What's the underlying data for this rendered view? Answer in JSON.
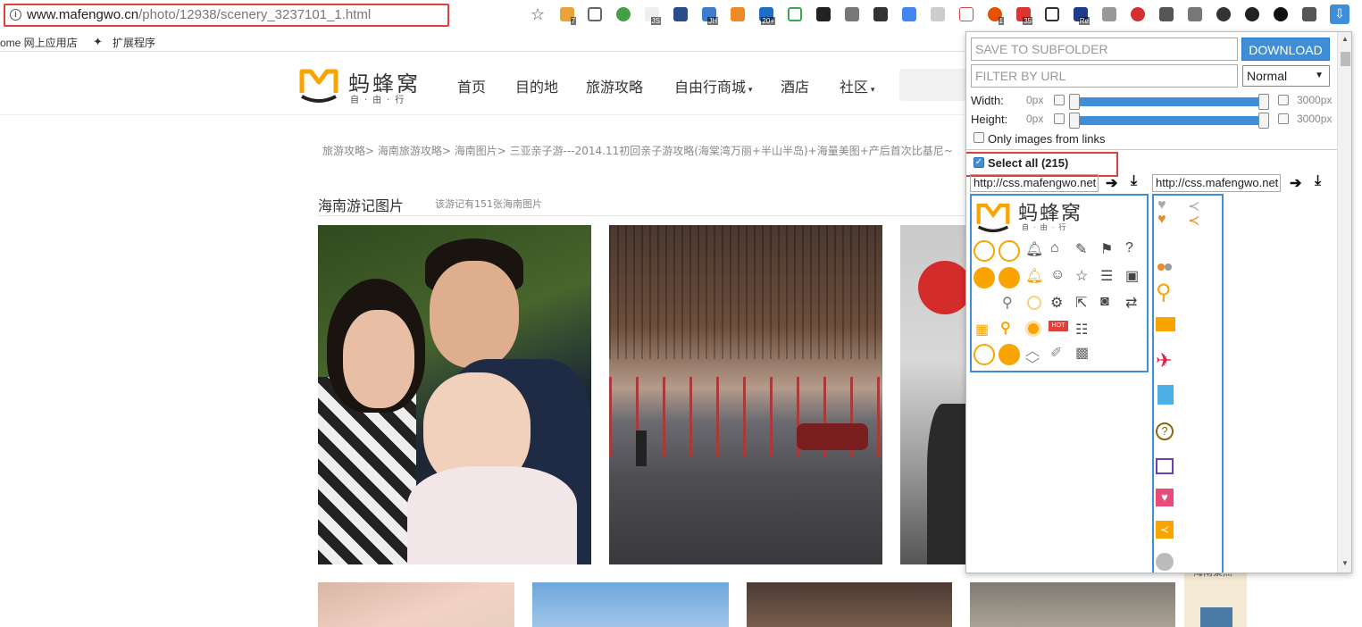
{
  "browser": {
    "url_host": "www.mafengwo.cn",
    "url_path": "/photo/12938/scenery_3237101_1.html",
    "bookmarks": [
      "ome 网上应用店",
      "扩展程序"
    ],
    "extension_badges": [
      "7",
      "JS",
      "JH",
      "20+",
      "1",
      "35",
      "Re"
    ]
  },
  "site": {
    "logo_text": "蚂蜂窝",
    "logo_sub": "自·由·行",
    "nav": [
      "首页",
      "目的地",
      "旅游攻略",
      "自由行商城",
      "酒店",
      "社区"
    ]
  },
  "content": {
    "breadcrumb": "旅游攻略> 海南旅游攻略> 海南图片> 三亚亲子游---2014.11初回亲子游攻略(海棠湾万丽+半山半岛)+海量美图+产后首次比基尼~",
    "section_title": "海南游记图片",
    "section_sub": "该游记有151张海南图片",
    "side_label": "海南景点"
  },
  "popup": {
    "subfolder_placeholder": "SAVE TO SUBFOLDER",
    "download_label": "DOWNLOAD",
    "filter_placeholder": "FILTER BY URL",
    "size_mode": "Normal",
    "width_label": "Width:",
    "height_label": "Height:",
    "min_px": "0px",
    "max_px": "3000px",
    "only_links_label": "Only images from links",
    "select_all_label": "Select all (215)",
    "url_chip_1": "http://css.mafengwo.net",
    "url_chip_2": "http://css.mafengwo.net",
    "preview_logo_text": "蚂蜂窝",
    "preview_logo_sub": "自·由·行",
    "hot_badge": "HOT"
  },
  "colors": {
    "accent_blue": "#3e8fd8",
    "highlight_red": "#e0403c",
    "brand_orange": "#f9a400"
  }
}
